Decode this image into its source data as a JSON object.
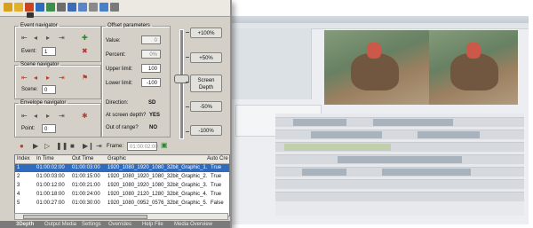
{
  "event_navigator": {
    "title": "Event navigator",
    "event_label": "Event:",
    "event_value": "1"
  },
  "scene_navigator": {
    "title": "Scene navigator",
    "scene_label": "Scene:",
    "scene_value": "0"
  },
  "envelope_navigator": {
    "title": "Envelope navigator",
    "point_label": "Point:",
    "point_value": "0"
  },
  "offset_parameters": {
    "title": "Offset parameters",
    "value_label": "Value:",
    "value": "0",
    "percent_label": "Percent:",
    "percent": "0%",
    "upper_label": "Upper limit:",
    "upper": "100",
    "lower_label": "Lower limit:",
    "lower": "-100",
    "direction_label": "Direction:",
    "direction": "SD",
    "at_depth_label": "At screen depth?",
    "at_depth": "YES",
    "out_of_range_label": "Out of range?",
    "out_of_range": "NO"
  },
  "depth_buttons": {
    "plus100": "+100%",
    "plus50": "+50%",
    "screen_depth": "Screen Depth",
    "minus50": "-50%",
    "minus100": "-100%"
  },
  "transport": {
    "frame_label": "Frame:",
    "frame_value": "01:00:02:00"
  },
  "table": {
    "columns": [
      "Index",
      "In Time",
      "Out Time",
      "Graphic",
      "Auto Cre"
    ],
    "rows": [
      [
        "1",
        "01:00:02:00",
        "01:00:03:00",
        "1920_1080_1920_1080_32bit_Graphic_1.png",
        "True"
      ],
      [
        "2",
        "01:00:03:00",
        "01:00:15:00",
        "1920_1080_1920_1080_32bit_Graphic_2.png",
        "True"
      ],
      [
        "3",
        "01:00:12:00",
        "01:00:21:00",
        "1920_1080_1920_1080_32bit_Graphic_3.png",
        "True"
      ],
      [
        "4",
        "01:00:18:00",
        "01:00:24:00",
        "1920_1080_2120_1280_32bit_Graphic_4.png",
        "True"
      ],
      [
        "5",
        "01:00:27:00",
        "01:00:30:00",
        "1920_1080_0952_0576_32bit_Graphic_5.png",
        "False"
      ]
    ]
  },
  "status_bar": [
    "3Depth",
    "Output Media",
    "Settings",
    "Overrides",
    "Help File",
    "Media Overview"
  ],
  "colors": {
    "window": "#d4d0c8",
    "selection": "#2f6cc0",
    "record": "#c0392b"
  }
}
